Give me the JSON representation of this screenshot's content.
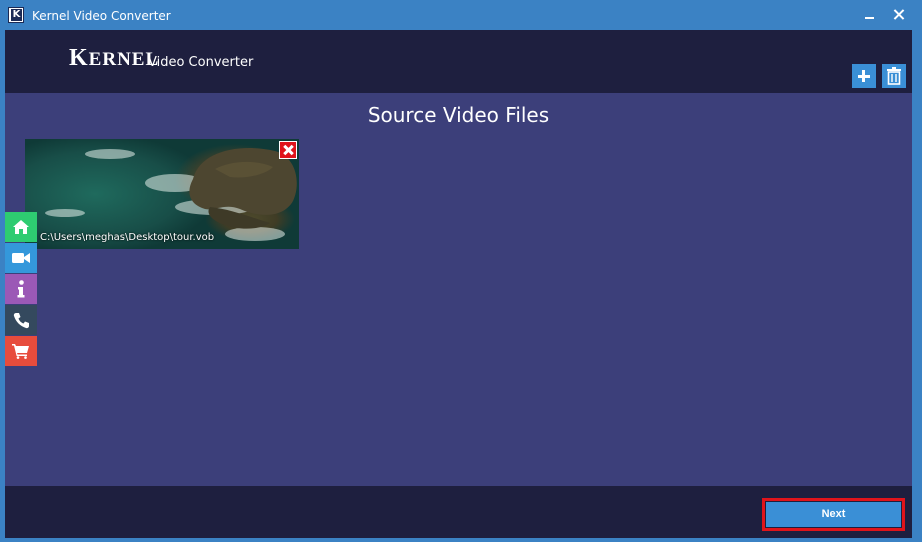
{
  "window": {
    "title": "Kernel Video Converter",
    "icon_letter": "K"
  },
  "header": {
    "logo_initial": "K",
    "logo_rest": "ERNEL",
    "logo_subtitle": "Video Converter",
    "add_icon": "plus-icon",
    "delete_icon": "trash-icon"
  },
  "main": {
    "section_title": "Source Video Files",
    "videos": [
      {
        "path": "C:\\Users\\meghas\\Desktop\\tour.vob"
      }
    ]
  },
  "side_nav": [
    {
      "icon": "home-icon",
      "color": "#2ecc71"
    },
    {
      "icon": "video-camera-icon",
      "color": "#3498db"
    },
    {
      "icon": "info-icon",
      "color": "#9b59b6"
    },
    {
      "icon": "phone-icon",
      "color": "#34495e"
    },
    {
      "icon": "cart-icon",
      "color": "#e74c3c"
    }
  ],
  "footer": {
    "next_label": "Next"
  },
  "colors": {
    "titlebar": "#3b82c4",
    "header_bg": "#1e1f3f",
    "main_bg": "#3c3f7a",
    "accent_button": "#3a8fd6",
    "highlight_border": "#e0141b"
  }
}
